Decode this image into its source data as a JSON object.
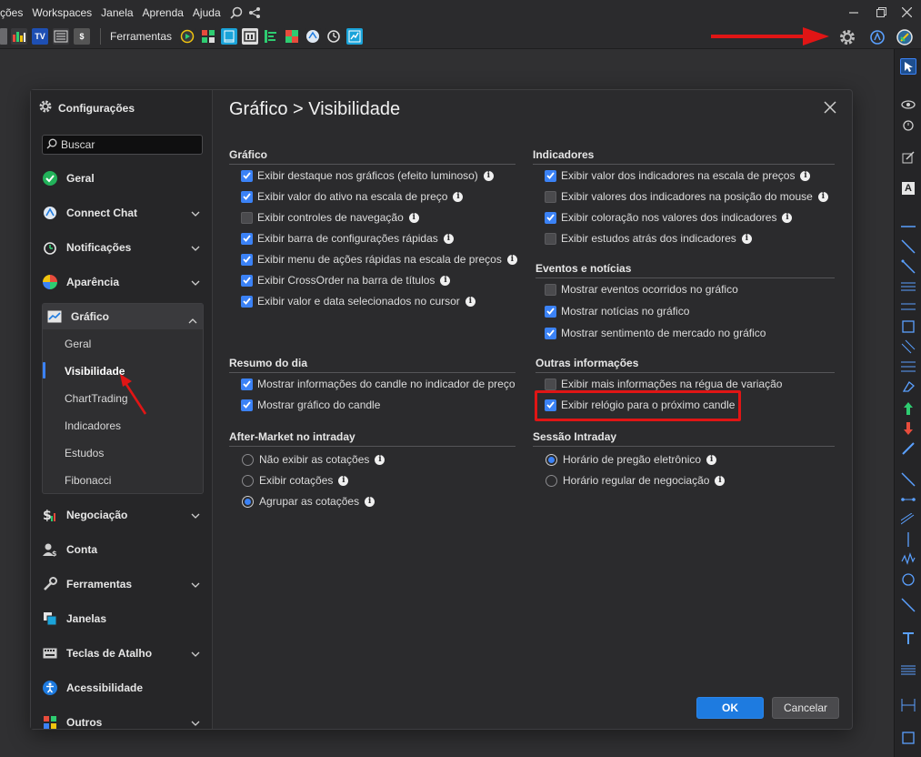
{
  "menubar": {
    "items": [
      "ções",
      "Workspaces",
      "Janela",
      "Aprenda",
      "Ajuda"
    ]
  },
  "toolbar": {
    "label": "Ferramentas",
    "left_icons": [
      "strategy-icon",
      "tv-icon",
      "news-icon",
      "dollar-icon"
    ],
    "tool_icons": [
      "replay-icon",
      "scanner-icon",
      "book-icon",
      "tape-icon",
      "ladder-icon",
      "heatmap-icon",
      "chat-icon",
      "clock-icon",
      "calculator-icon"
    ]
  },
  "dialog": {
    "sidebar_title": "Configurações",
    "search_placeholder": "Buscar",
    "nav": [
      {
        "label": "Geral",
        "icon": "check-circle-icon",
        "color": "#22b25a"
      },
      {
        "label": "Connect Chat",
        "icon": "chat-icon",
        "color": "#5aa0ff"
      },
      {
        "label": "Notificações",
        "icon": "alarm-icon",
        "color": "#2ecc71"
      },
      {
        "label": "Aparência",
        "icon": "palette-icon",
        "color": "#e74c3c"
      },
      {
        "label": "Gráfico",
        "icon": "chart-icon",
        "color": "#5aa0ff"
      },
      {
        "label": "Negociação",
        "icon": "money-icon",
        "color": "#f1c40f"
      },
      {
        "label": "Conta",
        "icon": "account-icon",
        "color": "#cccccc"
      },
      {
        "label": "Ferramentas",
        "icon": "wrench-icon",
        "color": "#cccccc"
      },
      {
        "label": "Janelas",
        "icon": "windows-icon",
        "color": "#5aa0ff"
      },
      {
        "label": "Teclas de Atalho",
        "icon": "keyboard-icon",
        "color": "#cccccc"
      },
      {
        "label": "Acessibilidade",
        "icon": "accessibility-icon",
        "color": "#1e7be0"
      },
      {
        "label": "Outros",
        "icon": "grid-icon",
        "color": "#e74c3c"
      }
    ],
    "grafico_sub": [
      "Geral",
      "Visibilidade",
      "ChartTrading",
      "Indicadores",
      "Estudos",
      "Fibonacci"
    ],
    "title": "Gráfico > Visibilidade",
    "sections": {
      "grafico": {
        "header": "Gráfico",
        "options": [
          {
            "label": "Exibir destaque nos gráficos (efeito luminoso)",
            "checked": true,
            "info": true
          },
          {
            "label": "Exibir valor do ativo na escala de preço",
            "checked": true,
            "info": true
          },
          {
            "label": "Exibir controles de navegação",
            "checked": false,
            "info": true
          },
          {
            "label": "Exibir barra de configurações rápidas",
            "checked": true,
            "info": true
          },
          {
            "label": "Exibir menu de ações rápidas na escala de preços",
            "checked": true,
            "info": true
          },
          {
            "label": "Exibir CrossOrder na barra de títulos",
            "checked": true,
            "info": true
          },
          {
            "label": "Exibir valor e data selecionados no cursor",
            "checked": true,
            "info": true
          }
        ]
      },
      "indicadores": {
        "header": "Indicadores",
        "options": [
          {
            "label": "Exibir valor dos indicadores na escala de preços",
            "checked": true,
            "info": true
          },
          {
            "label": "Exibir valores dos indicadores na posição do mouse",
            "checked": false,
            "info": true
          },
          {
            "label": "Exibir coloração nos valores dos indicadores",
            "checked": true,
            "info": true
          },
          {
            "label": "Exibir estudos atrás dos indicadores",
            "checked": false,
            "info": true
          }
        ]
      },
      "eventos": {
        "header": "Eventos e notícias",
        "options": [
          {
            "label": "Mostrar eventos ocorridos no gráfico",
            "checked": false,
            "info": false
          },
          {
            "label": "Mostrar notícias no gráfico",
            "checked": true,
            "info": false
          },
          {
            "label": "Mostrar sentimento de mercado no gráfico",
            "checked": true,
            "info": false
          }
        ]
      },
      "resumo": {
        "header": "Resumo do dia",
        "options": [
          {
            "label": "Mostrar informações do candle no indicador de preço",
            "checked": true,
            "info": false
          },
          {
            "label": "Mostrar gráfico do candle",
            "checked": true,
            "info": false
          }
        ]
      },
      "outras": {
        "header": "Outras informações",
        "options": [
          {
            "label": "Exibir mais informações na régua de variação",
            "checked": false,
            "info": false
          },
          {
            "label": "Exibir relógio para o próximo candle",
            "checked": true,
            "info": false
          }
        ]
      },
      "aftermarket": {
        "header": "After-Market no intraday",
        "options": [
          {
            "label": "Não exibir as cotações",
            "selected": false,
            "info": true
          },
          {
            "label": "Exibir cotações",
            "selected": false,
            "info": true
          },
          {
            "label": "Agrupar as cotações",
            "selected": true,
            "info": true
          }
        ]
      },
      "sessao": {
        "header": "Sessão Intraday",
        "options": [
          {
            "label": "Horário de pregão eletrônico",
            "selected": true,
            "info": true
          },
          {
            "label": "Horário regular de negociação",
            "selected": false,
            "info": true
          }
        ]
      }
    },
    "ok_label": "OK",
    "cancel_label": "Cancelar"
  },
  "accent_color": "#3b82f6",
  "highlight_color": "#e01515"
}
